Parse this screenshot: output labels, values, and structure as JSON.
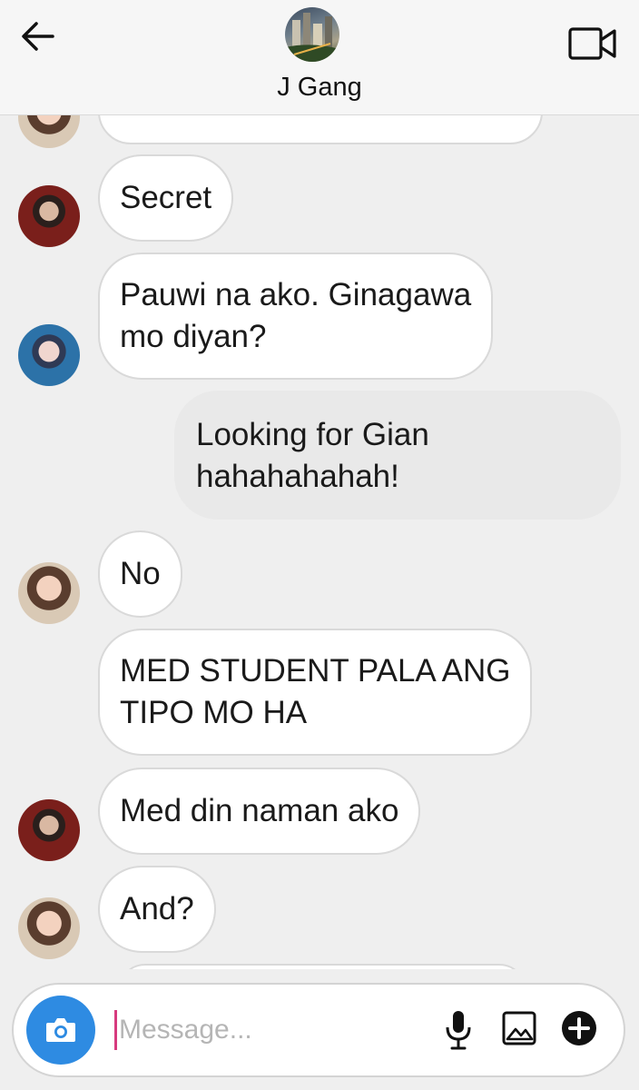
{
  "header": {
    "title": "J Gang",
    "back_icon": "arrow-left-icon",
    "video_icon": "video-camera-icon"
  },
  "messages": [
    {
      "sender": "a",
      "text": "",
      "partial": true
    },
    {
      "sender": "b",
      "lines": [
        "Secret"
      ]
    },
    {
      "sender": "c",
      "lines": [
        "Pauwi na ako. Ginagawa",
        "mo diyan?"
      ]
    },
    {
      "sender": "me",
      "lines": [
        "Looking for Gian",
        "hahahahahah!"
      ]
    },
    {
      "sender": "a",
      "lines": [
        "No"
      ]
    },
    {
      "sender": "a",
      "lines": [
        "MED STUDENT PALA ANG",
        "TIPO MO HA"
      ]
    },
    {
      "sender": "b",
      "lines": [
        "Med din naman ako"
      ]
    },
    {
      "sender": "a",
      "lines": [
        "And?"
      ]
    }
  ],
  "composer": {
    "placeholder": "Message...",
    "value": "",
    "icons": [
      "camera-icon",
      "microphone-icon",
      "image-icon",
      "plus-circle-icon"
    ]
  },
  "colors": {
    "accent_blue": "#2e8be2",
    "cursor_pink": "#d73a7e",
    "background": "#efefef"
  }
}
